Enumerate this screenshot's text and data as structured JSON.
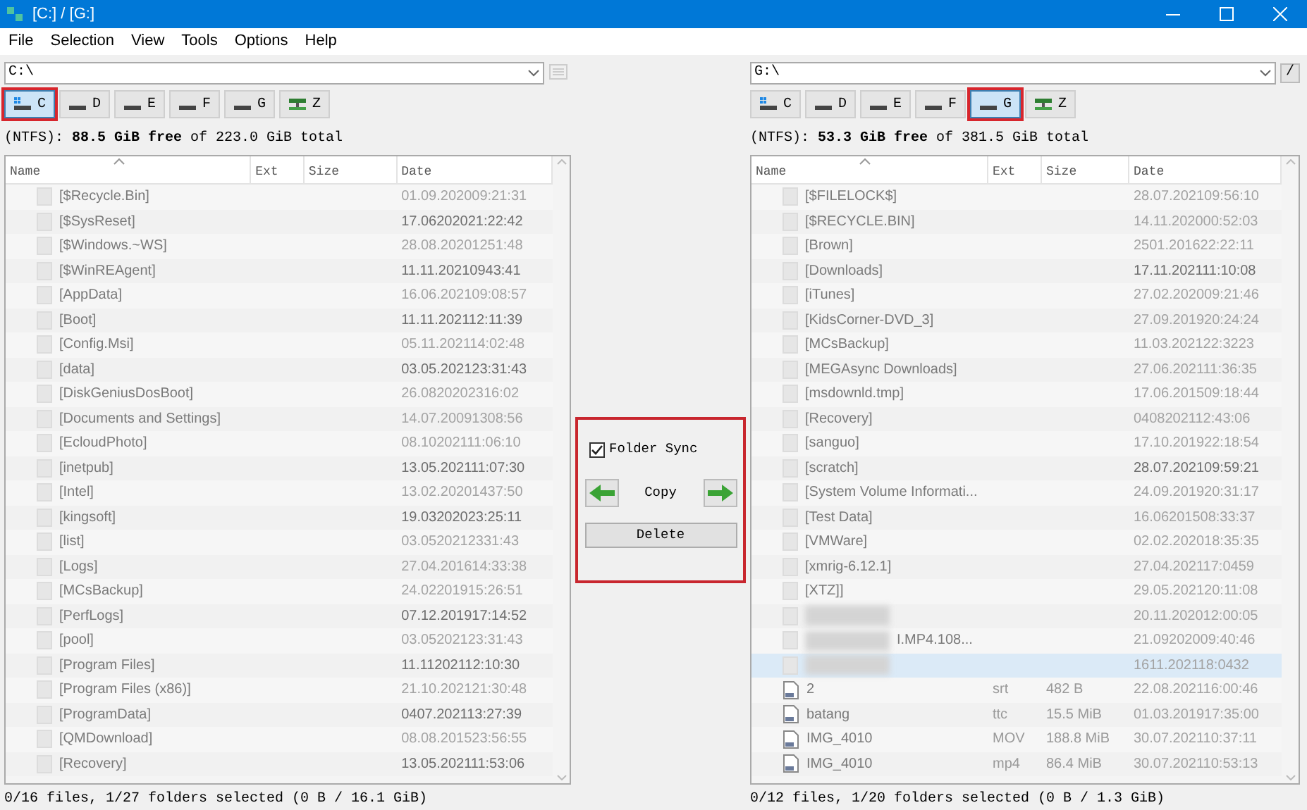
{
  "window": {
    "title": "[C:] / [G:]"
  },
  "menu": [
    "File",
    "Selection",
    "View",
    "Tools",
    "Options",
    "Help"
  ],
  "panels": [
    {
      "path": "C:\\",
      "side_button": {
        "kind": "icon"
      },
      "drives": [
        {
          "letter": "C",
          "kind": "system",
          "selected": true
        },
        {
          "letter": "D",
          "kind": "disk",
          "selected": false
        },
        {
          "letter": "E",
          "kind": "disk",
          "selected": false
        },
        {
          "letter": "F",
          "kind": "disk",
          "selected": false
        },
        {
          "letter": "G",
          "kind": "disk",
          "selected": false
        },
        {
          "letter": "Z",
          "kind": "network",
          "selected": false
        }
      ],
      "info": "(NTFS): **88.5 GiB free** of 223.0 GiB total",
      "columns": [
        "Name",
        "Ext",
        "Size",
        "Date"
      ],
      "rows": [
        {
          "kind": "folder",
          "name": "[$Recycle.Bin]",
          "date": "01.09.202009:21:31",
          "dim": true,
          "selected": false
        },
        {
          "kind": "folder",
          "name": "[$SysReset]",
          "date": "17.06202021:22:42",
          "dim": false,
          "selected": false
        },
        {
          "kind": "folder",
          "name": "[$Windows.~WS]",
          "date": "28.08.20201251:48",
          "dim": true,
          "selected": false
        },
        {
          "kind": "folder",
          "name": "[$WinREAgent]",
          "date": "11.11.20210943:41",
          "dim": false,
          "selected": false
        },
        {
          "kind": "folder",
          "name": "[AppData]",
          "date": "16.06.202109:08:57",
          "dim": true,
          "selected": false
        },
        {
          "kind": "folder",
          "name": "[Boot]",
          "date": "11.11.202112:11:39",
          "dim": false,
          "selected": false
        },
        {
          "kind": "folder",
          "name": "[Config.Msi]",
          "date": "05.11.202114:02:48",
          "dim": true,
          "selected": false
        },
        {
          "kind": "folder",
          "name": "[data]",
          "date": "03.05.202123:31:43",
          "dim": false,
          "selected": false
        },
        {
          "kind": "folder",
          "name": "[DiskGeniusDosBoot]",
          "date": "26.0820202316:02",
          "dim": true,
          "selected": false
        },
        {
          "kind": "folder",
          "name": "[Documents and Settings]",
          "date": "14.07.20091308:56",
          "dim": true,
          "selected": false
        },
        {
          "kind": "folder",
          "name": "[EcloudPhoto]",
          "date": "08.10202111:06:10",
          "dim": true,
          "selected": false
        },
        {
          "kind": "folder",
          "name": "[inetpub]",
          "date": "13.05.202111:07:30",
          "dim": false,
          "selected": false
        },
        {
          "kind": "folder",
          "name": "[Intel]",
          "date": "13.02.20201437:50",
          "dim": true,
          "selected": false
        },
        {
          "kind": "folder",
          "name": "[kingsoft]",
          "date": "19.03202023:25:11",
          "dim": false,
          "selected": false
        },
        {
          "kind": "folder",
          "name": "[list]",
          "date": "03.0520212331:43",
          "dim": true,
          "selected": false
        },
        {
          "kind": "folder",
          "name": "[Logs]",
          "date": "27.04.201614:33:38",
          "dim": true,
          "selected": false
        },
        {
          "kind": "folder",
          "name": "[MCsBackup]",
          "date": "24.02201915:26:51",
          "dim": true,
          "selected": false
        },
        {
          "kind": "folder",
          "name": "[PerfLogs]",
          "date": "07.12.201917:14:52",
          "dim": false,
          "selected": false
        },
        {
          "kind": "folder",
          "name": "[pool]",
          "date": "03.05202123:31:43",
          "dim": true,
          "selected": false
        },
        {
          "kind": "folder",
          "name": "[Program Files]",
          "date": "11.11202112:10:30",
          "dim": false,
          "selected": false
        },
        {
          "kind": "folder",
          "name": "[Program Files (x86)]",
          "date": "21.10.202121:30:48",
          "dim": true,
          "selected": false
        },
        {
          "kind": "folder",
          "name": "[ProgramData]",
          "date": "0407.202113:27:39",
          "dim": false,
          "selected": false
        },
        {
          "kind": "folder",
          "name": "[QMDownload]",
          "date": "08.08.201523:56:55",
          "dim": true,
          "selected": false
        },
        {
          "kind": "folder",
          "name": "[Recovery]",
          "date": "13.05.202111:53:06",
          "dim": false,
          "selected": false
        }
      ],
      "status": "0/16 files, 1/27 folders selected (0 B / 16.1 GiB)"
    },
    {
      "path": "G:\\",
      "side_button": {
        "kind": "text",
        "label": "/"
      },
      "drives": [
        {
          "letter": "C",
          "kind": "system",
          "selected": false
        },
        {
          "letter": "D",
          "kind": "disk",
          "selected": false
        },
        {
          "letter": "E",
          "kind": "disk",
          "selected": false
        },
        {
          "letter": "F",
          "kind": "disk",
          "selected": false
        },
        {
          "letter": "G",
          "kind": "disk",
          "selected": true
        },
        {
          "letter": "Z",
          "kind": "network",
          "selected": false
        }
      ],
      "info": "(NTFS): **53.3 GiB free** of 381.5 GiB total",
      "columns": [
        "Name",
        "Ext",
        "Size",
        "Date"
      ],
      "rows": [
        {
          "kind": "folder",
          "name": "[$FILELOCK$]",
          "date": "28.07.202109:56:10",
          "dim": true,
          "selected": false
        },
        {
          "kind": "folder",
          "name": "[$RECYCLE.BIN]",
          "date": "14.11.202000:52:03",
          "dim": true,
          "selected": false
        },
        {
          "kind": "folder",
          "name": "[Brown]",
          "date": "2501.201622:22:11",
          "dim": true,
          "selected": false
        },
        {
          "kind": "folder",
          "name": "[Downloads]",
          "date": "17.11.202111:10:08",
          "dim": false,
          "selected": false
        },
        {
          "kind": "folder",
          "name": "[iTunes]",
          "date": "27.02.202009:21:46",
          "dim": true,
          "selected": false
        },
        {
          "kind": "folder",
          "name": "[KidsCorner-DVD_3]",
          "date": "27.09.201920:24:24",
          "dim": true,
          "selected": false
        },
        {
          "kind": "folder",
          "name": "[MCsBackup]",
          "date": "11.03.202122:3223",
          "dim": true,
          "selected": false
        },
        {
          "kind": "folder",
          "name": "[MEGAsync Downloads]",
          "date": "27.06.202111:36:35",
          "dim": true,
          "selected": false
        },
        {
          "kind": "folder",
          "name": "[msdownld.tmp]",
          "date": "17.06.201509:18:44",
          "dim": true,
          "selected": false
        },
        {
          "kind": "folder",
          "name": "[Recovery]",
          "date": "0408202112:43:06",
          "dim": true,
          "selected": false
        },
        {
          "kind": "folder",
          "name": "[sanguo]",
          "date": "17.10.201922:18:54",
          "dim": true,
          "selected": false
        },
        {
          "kind": "folder",
          "name": "[scratch]",
          "date": "28.07.202109:59:21",
          "dim": false,
          "selected": false
        },
        {
          "kind": "folder",
          "name": "[System Volume Informati...",
          "date": "24.09.201920:31:17",
          "dim": true,
          "selected": false
        },
        {
          "kind": "folder",
          "name": "[Test Data]",
          "date": "16.06201508:33:37",
          "dim": true,
          "selected": false
        },
        {
          "kind": "folder",
          "name": "[VMWare]",
          "date": "02.02.202018:35:35",
          "dim": true,
          "selected": false
        },
        {
          "kind": "folder",
          "name": "[xmrig-6.12.1]",
          "date": "27.04.202117:0459",
          "dim": true,
          "selected": false
        },
        {
          "kind": "folder",
          "name": "[XTZ]]",
          "date": "29.05.202120:11:08",
          "dim": true,
          "selected": false
        },
        {
          "kind": "blurred",
          "date": "20.11.202012:00:05",
          "dim": true,
          "selected": false
        },
        {
          "kind": "blurred",
          "name": "I.MP4.108...",
          "date": "21.09202009:40:46",
          "dim": true,
          "selected": false
        },
        {
          "kind": "blurred",
          "date": "1611.202118:0432",
          "dim": true,
          "selected": true
        },
        {
          "kind": "file",
          "name": "2",
          "ext": "srt",
          "size": "482 B",
          "date": "22.08.202116:00:46",
          "dim": true,
          "selected": false
        },
        {
          "kind": "file",
          "name": "batang",
          "ext": "ttc",
          "size": "15.5 MiB",
          "date": "01.03.201917:35:00",
          "dim": true,
          "selected": false
        },
        {
          "kind": "file",
          "name": "IMG_4010",
          "ext": "MOV",
          "size": "188.8 MiB",
          "date": "30.07.202110:37:11",
          "dim": true,
          "selected": false
        },
        {
          "kind": "file",
          "name": "IMG_4010",
          "ext": "mp4",
          "size": "86.4 MiB",
          "date": "30.07.202110:53:13",
          "dim": true,
          "selected": false
        }
      ],
      "status": "0/12 files, 1/20 folders selected (0 B / 1.3 GiB)"
    }
  ],
  "sync": {
    "checkbox": {
      "label": "Folder Sync",
      "checked": true
    },
    "copy_label": "Copy",
    "delete_label": "Delete"
  }
}
